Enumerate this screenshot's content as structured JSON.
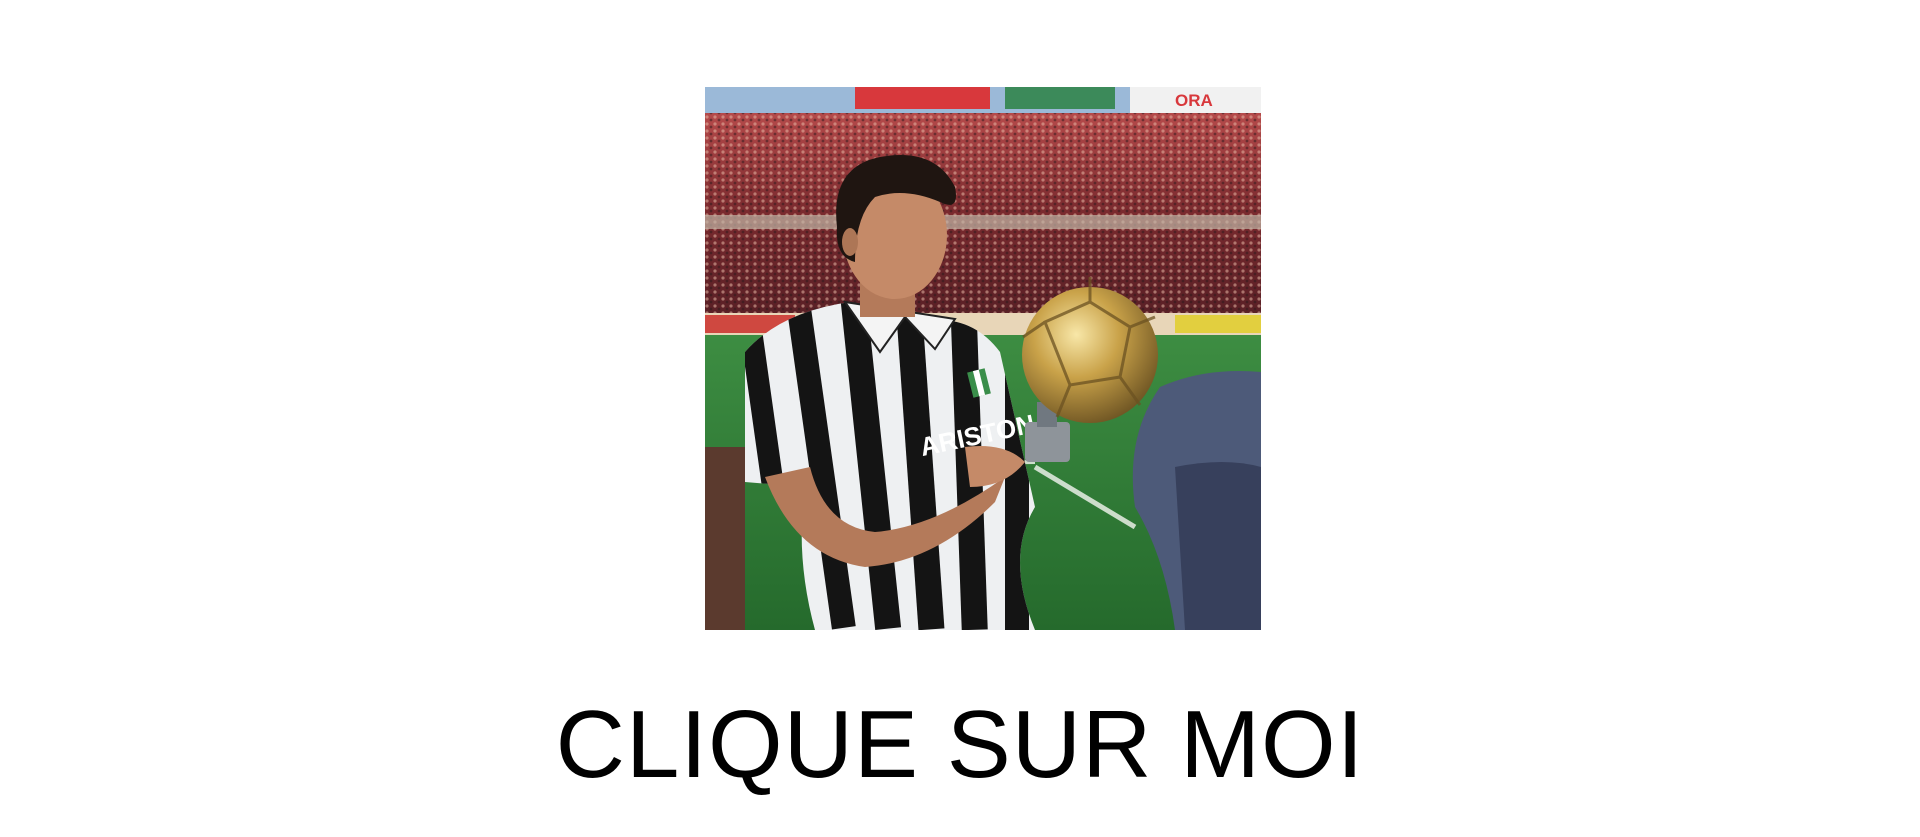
{
  "photo": {
    "subject": "footballer in black-and-white striped shirt holding golden ball trophy",
    "shirt_sponsor": "ARISTON",
    "stadium_banners": [
      "",
      "",
      "ORA"
    ],
    "colors": {
      "sky": "#9bb9d8",
      "crowd": "#7a2a2e",
      "pitch": "#2f7a36",
      "stripe_dark": "#141414",
      "stripe_light": "#eef0f2",
      "gold": "#c9a249",
      "suit": "#4d5a79"
    }
  },
  "cta": {
    "label": "CLIQUE SUR MOI",
    "color": "#000000"
  }
}
